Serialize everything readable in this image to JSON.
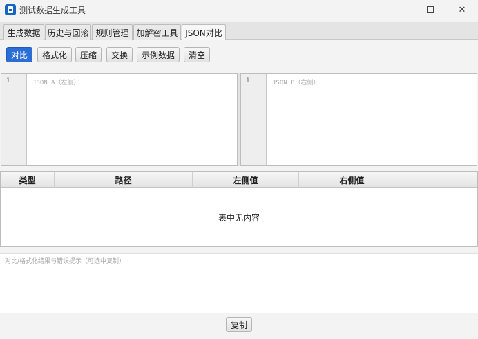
{
  "window": {
    "title": "测试数据生成工具",
    "minimize_glyph": "—",
    "close_glyph": "✕"
  },
  "tabs": [
    {
      "label": "生成数据",
      "active": false
    },
    {
      "label": "历史与回滚",
      "active": false
    },
    {
      "label": "规则管理",
      "active": false
    },
    {
      "label": "加解密工具",
      "active": false
    },
    {
      "label": "JSON对比",
      "active": true
    }
  ],
  "toolbar": {
    "compare": "对比",
    "format": "格式化",
    "compress": "压缩",
    "swap": "交换",
    "sample": "示例数据",
    "clear": "清空"
  },
  "editor_a": {
    "line_number": "1",
    "placeholder": "JSON A（左侧）"
  },
  "editor_b": {
    "line_number": "1",
    "placeholder": "JSON B（右侧）"
  },
  "diff_table": {
    "columns": [
      "类型",
      "路径",
      "左侧值",
      "右侧值"
    ],
    "empty_message": "表中无内容"
  },
  "output": {
    "placeholder": "对比/格式化结果与错误提示（可选中复制）"
  },
  "copy_button": "复制",
  "colors": {
    "accent": "#2b6fd6",
    "app_icon": "#1565c0"
  }
}
